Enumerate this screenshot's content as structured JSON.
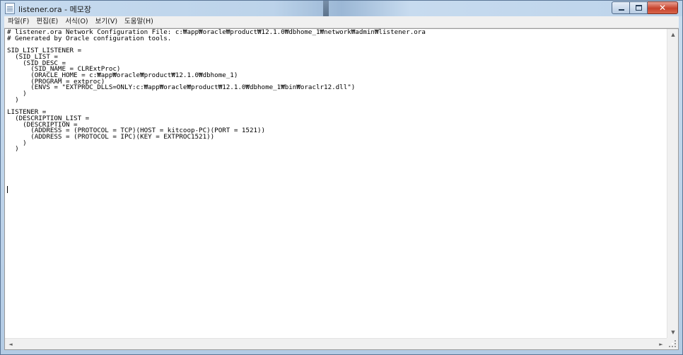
{
  "window": {
    "title": "listener.ora - 메모장",
    "icon": "notepad-icon",
    "background_text": "",
    "caption_buttons": {
      "minimize": "minimize-icon",
      "maximize": "maximize-icon",
      "close": "close-icon"
    }
  },
  "menu": {
    "items": [
      {
        "label": "파일(F)"
      },
      {
        "label": "편집(E)"
      },
      {
        "label": "서식(O)"
      },
      {
        "label": "보기(V)"
      },
      {
        "label": "도움말(H)"
      }
    ]
  },
  "editor": {
    "content": "# listener.ora Network Configuration File: c:₩app₩oracle₩product₩12.1.0₩dbhome_1₩network₩admin₩listener.ora\n# Generated by Oracle configuration tools.\n\nSID_LIST_LISTENER =\n  (SID_LIST =\n    (SID_DESC =\n      (SID_NAME = CLRExtProc)\n      (ORACLE_HOME = c:₩app₩oracle₩product₩12.1.0₩dbhome_1)\n      (PROGRAM = extproc)\n      (ENVS = \"EXTPROC_DLLS=ONLY:c:₩app₩oracle₩product₩12.1.0₩dbhome_1₩bin₩oraclr12.dll\")\n    )\n  )\n\nLISTENER =\n  (DESCRIPTION_LIST =\n    (DESCRIPTION =\n      (ADDRESS = (PROTOCOL = TCP)(HOST = kitcoop-PC)(PORT = 1521))\n      (ADDRESS = (PROTOCOL = IPC)(KEY = EXTPROC1521))\n    )\n  )\n"
  },
  "scrollbars": {
    "up": "▲",
    "down": "▼",
    "left": "◄",
    "right": "►"
  }
}
